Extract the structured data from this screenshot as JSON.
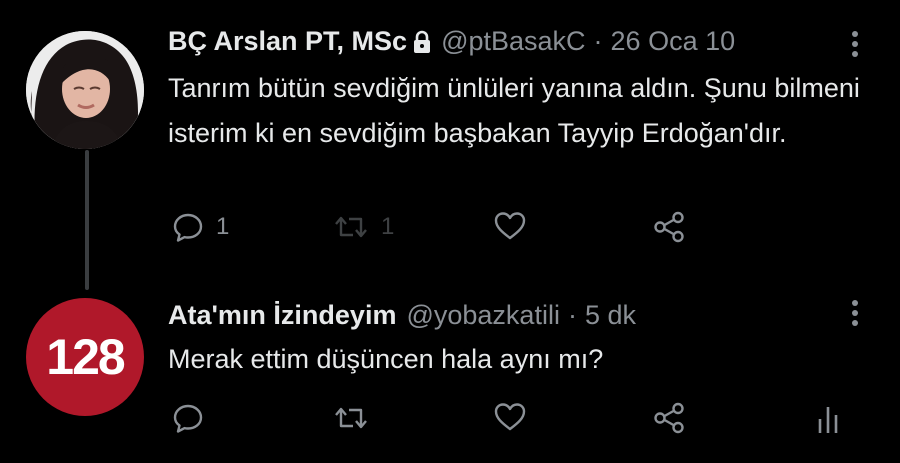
{
  "tweets": [
    {
      "author_name": "BÇ Arslan PT, MSc",
      "handle": "@ptBasakC",
      "separator": "·",
      "time": "26 Oca 10",
      "text": "Tanrım bütün sevdiğim ünlüleri yanına aldın. Şunu bilmeni isterim ki en sevdiğim başbakan Tayyip Erdoğan'dır.",
      "reply_count": "1",
      "retweet_count": "1",
      "protected": true
    },
    {
      "author_name": "Ata'mın İzindeyim",
      "handle": "@yobazkatili",
      "separator": "·",
      "time": "5 dk",
      "text": "Merak ettim düşüncen hala aynı mı?",
      "avatar_text": "128"
    }
  ],
  "colors": {
    "background": "#000000",
    "text_primary": "#e7e9ea",
    "text_secondary": "#8b9096",
    "thread_line": "#3a3d40",
    "avatar_badge": "#b0182a"
  },
  "icons": [
    "reply-icon",
    "retweet-icon",
    "like-icon",
    "share-icon",
    "lock-icon",
    "more-icon",
    "analytics-icon"
  ]
}
